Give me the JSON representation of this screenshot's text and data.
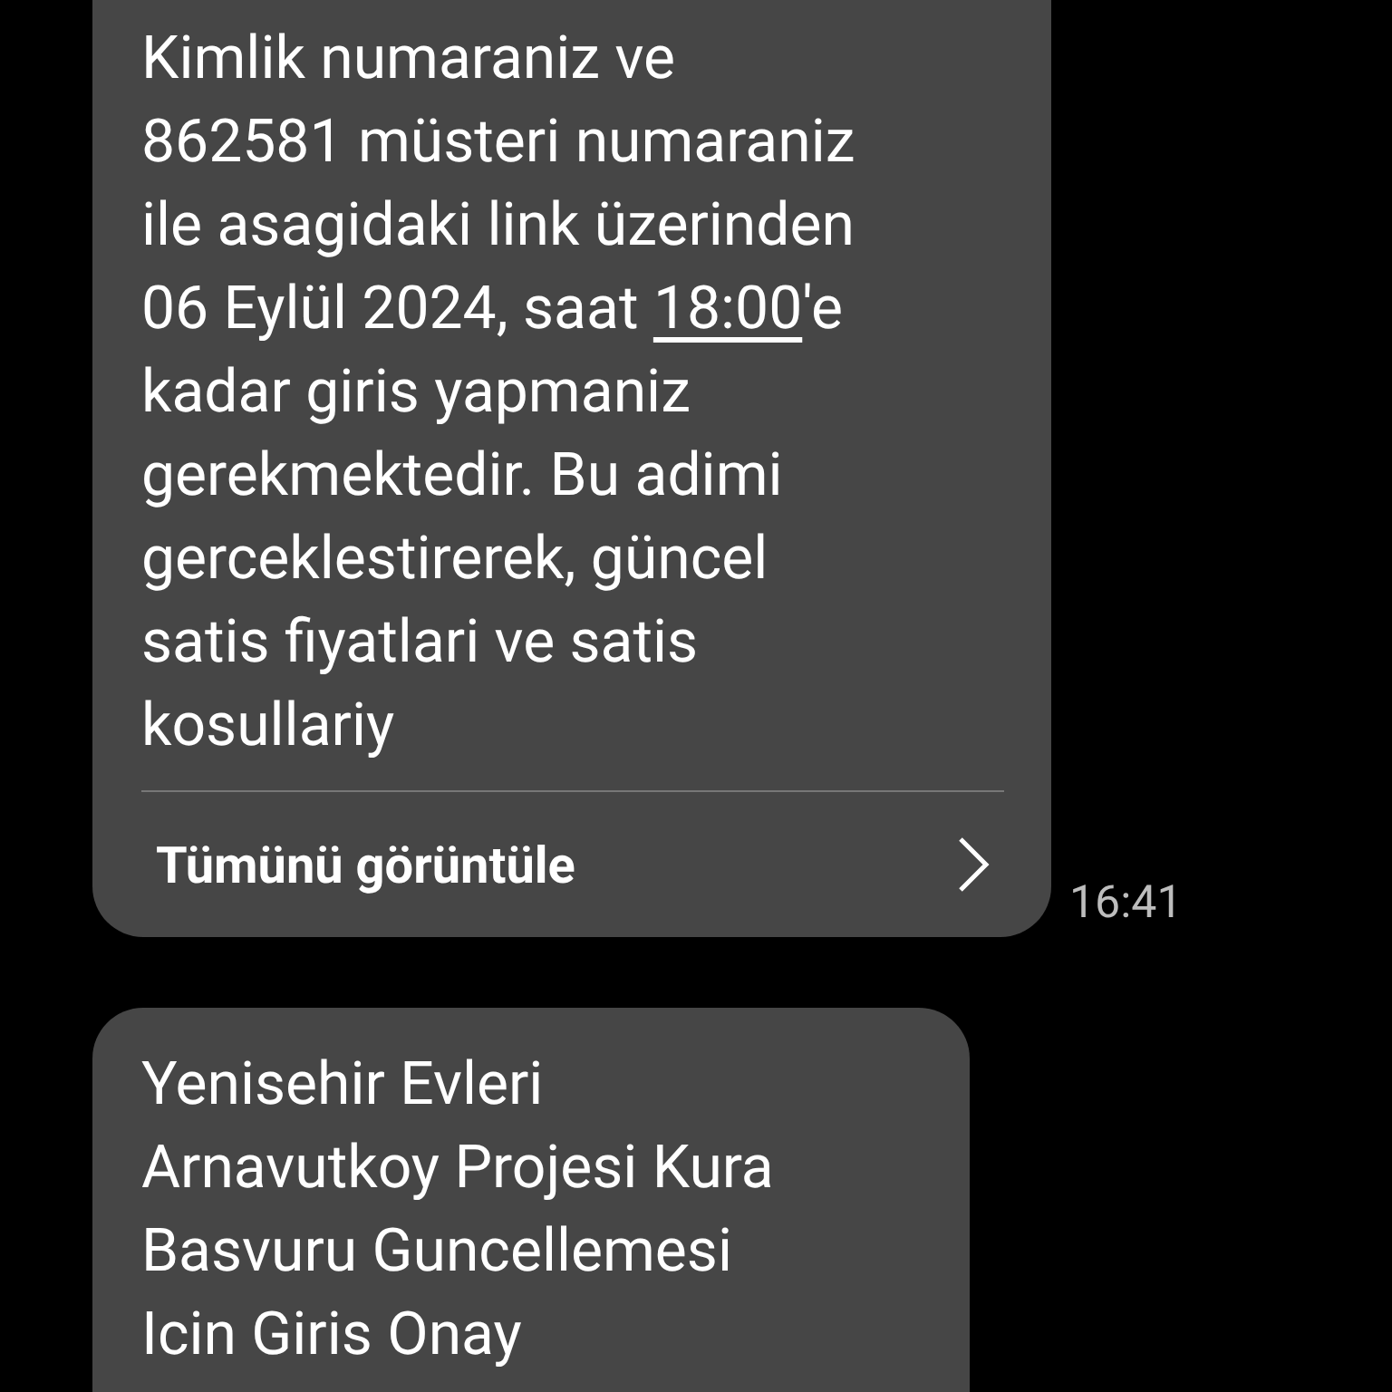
{
  "messages": [
    {
      "body": [
        {
          "kind": "text",
          "text": "Kimlik numaraniz ve\n862581 müsteri numaraniz\nile asagidaki link üzerinden\n06 Eylül 2024, saat "
        },
        {
          "kind": "link",
          "text": "18:00"
        },
        {
          "kind": "text",
          "text": "'e\nkadar giris yapmaniz\ngerekmektedir. Bu adimi\ngerceklestirerek, güncel\nsatis fiyatlari ve satis\nkosullariy"
        }
      ],
      "view_all": "Tümünü görüntüle",
      "time": "16:41"
    },
    {
      "body": [
        {
          "kind": "text",
          "text": "Yenisehir Evleri\nArnavutkoy Projesi Kura\nBasvuru Guncellemesi\nIcin Giris Onay"
        }
      ]
    }
  ]
}
